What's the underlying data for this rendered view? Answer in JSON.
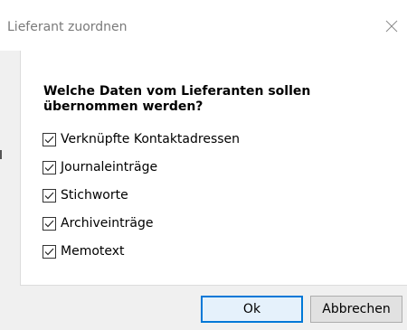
{
  "window": {
    "title": "Lieferant zuordnen",
    "close_icon": "close-icon"
  },
  "dialog": {
    "question": "Welche Daten vom Lieferanten sollen übernommen werden?",
    "options": [
      {
        "label": "Verknüpfte Kontaktadressen",
        "checked": true
      },
      {
        "label": "Journaleinträge",
        "checked": true
      },
      {
        "label": "Stichworte",
        "checked": true
      },
      {
        "label": "Archiveinträge",
        "checked": true
      },
      {
        "label": "Memotext",
        "checked": true
      }
    ]
  },
  "buttons": {
    "ok_label": "Ok",
    "cancel_label": "Abbrechen"
  },
  "colors": {
    "accent": "#0078d7",
    "ok_background": "#e5f1fb",
    "window_background": "#f0f0f0"
  }
}
